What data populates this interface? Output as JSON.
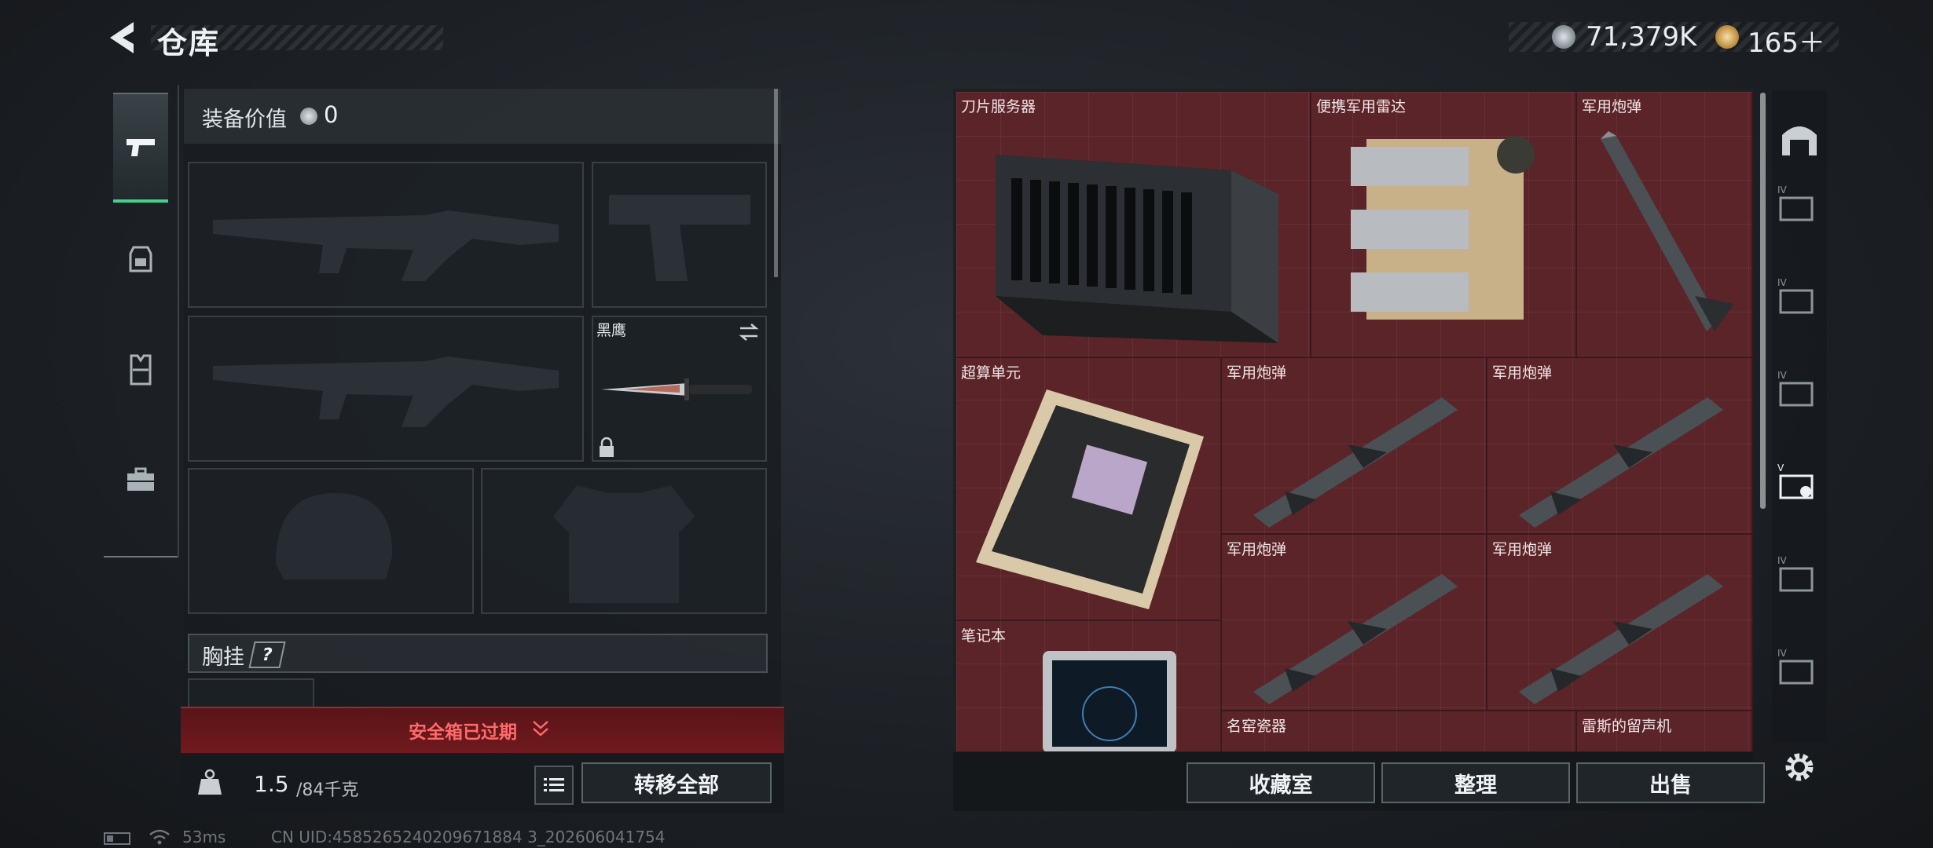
{
  "header": {
    "title": "仓库",
    "money": "71,379K",
    "tokens": "165＋",
    "money_icon": "silver-coin-icon",
    "token_icon": "gold-coin-icon"
  },
  "left_tabs": [
    {
      "name": "weapons",
      "icon": "pistol-icon",
      "active": true
    },
    {
      "name": "backpack",
      "icon": "backpack-icon",
      "active": false
    },
    {
      "name": "vest",
      "icon": "vest-icon",
      "active": false
    },
    {
      "name": "case",
      "icon": "toolbox-icon",
      "active": false
    }
  ],
  "equipment": {
    "label": "装备价值",
    "value": "0",
    "melee_name": "黑鹰",
    "rig_label": "胸挂",
    "rig_help": "?"
  },
  "secure_box": {
    "text": "安全箱已过期",
    "color": "#ff6a6a"
  },
  "bottom_left": {
    "weight_value": "1.5",
    "weight_unit": "/84千克",
    "transfer_all": "转移全部"
  },
  "storage": {
    "background": "#5b2429",
    "items": [
      {
        "name": "刀片服务器"
      },
      {
        "name": "便携军用雷达"
      },
      {
        "name": "军用炮弹"
      },
      {
        "name": "超算单元"
      },
      {
        "name": "军用炮弹"
      },
      {
        "name": "军用炮弹"
      },
      {
        "name": "军用炮弹"
      },
      {
        "name": "军用炮弹"
      },
      {
        "name": "笔记本"
      },
      {
        "name": "名窑瓷器"
      },
      {
        "name": "雷斯的留声机"
      }
    ]
  },
  "bottom_right": {
    "collection": "收藏室",
    "sort": "整理",
    "sell": "出售"
  },
  "status": {
    "ping": "53ms",
    "uid": "CN UID:4585265240209671884 3_202606041754"
  }
}
